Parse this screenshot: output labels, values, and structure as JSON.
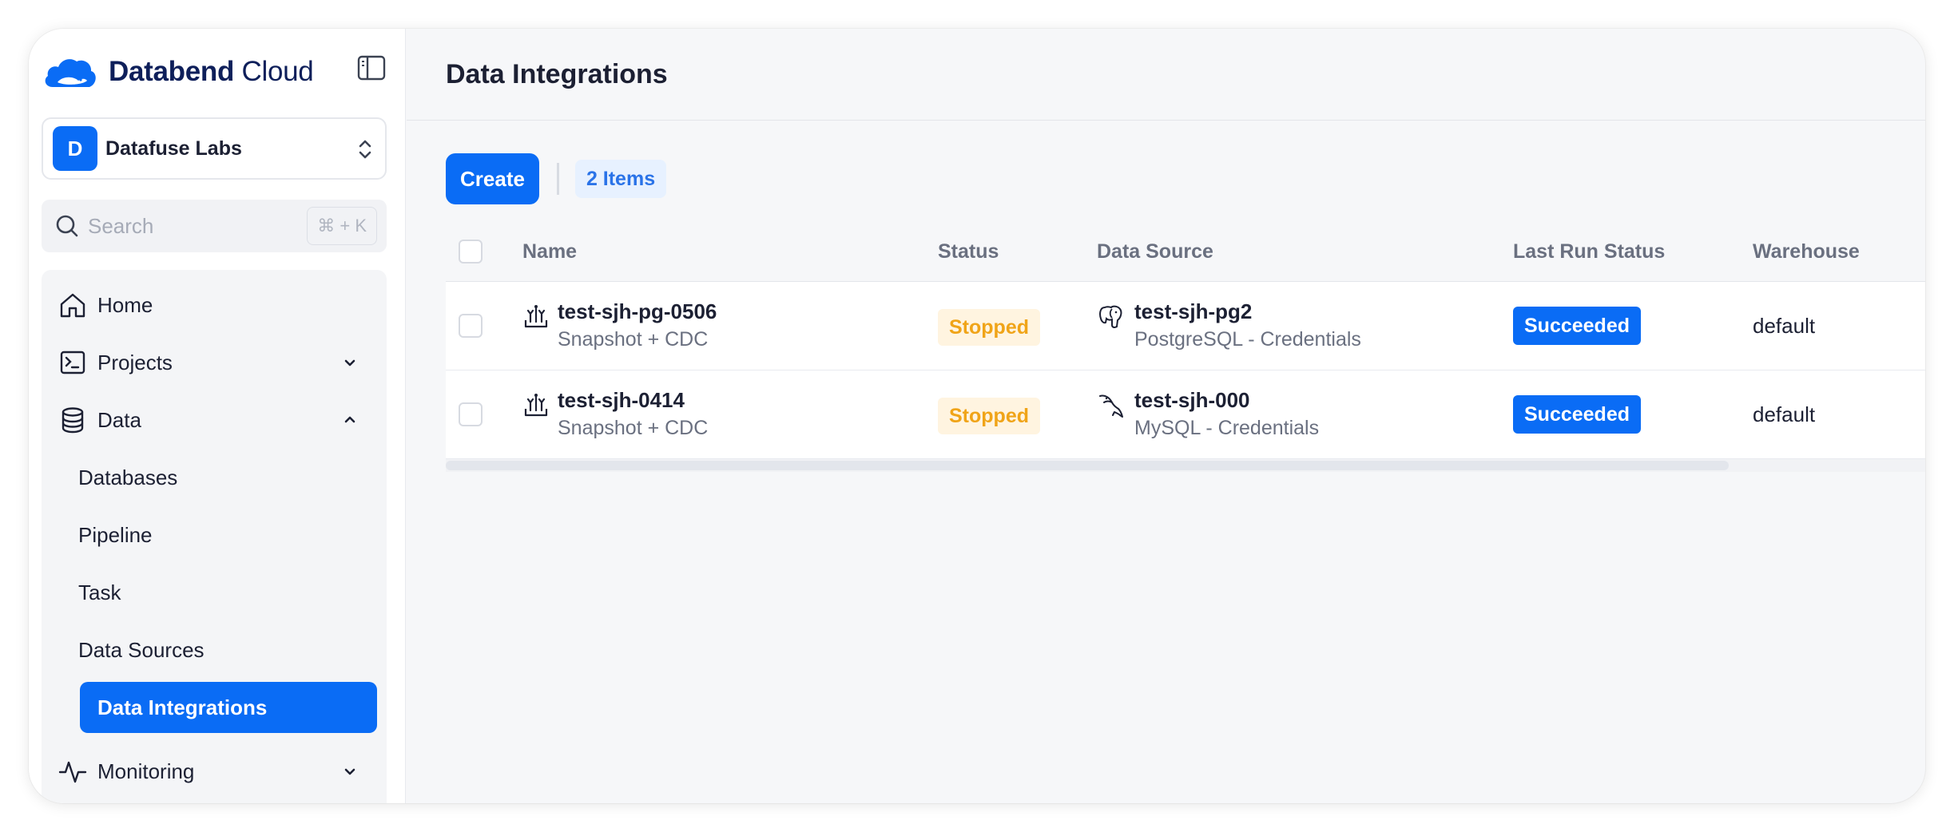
{
  "brand": {
    "name_bold": "Databend",
    "name_light": " Cloud"
  },
  "org": {
    "initial": "D",
    "name": "Datafuse Labs"
  },
  "search": {
    "placeholder": "Search",
    "shortcut": "⌘ + K"
  },
  "nav": {
    "home": "Home",
    "projects": "Projects",
    "data": "Data",
    "data_children": [
      "Databases",
      "Pipeline",
      "Task",
      "Data Sources",
      "Data Integrations"
    ],
    "monitoring": "Monitoring",
    "active": "Data Integrations"
  },
  "page": {
    "title": "Data Integrations"
  },
  "toolbar": {
    "create_label": "Create",
    "count_label": "2 Items"
  },
  "table": {
    "columns": [
      "Name",
      "Status",
      "Data Source",
      "Last Run Status",
      "Warehouse"
    ],
    "rows": [
      {
        "name": "test-sjh-pg-0506",
        "mode": "Snapshot + CDC",
        "status": "Stopped",
        "source_name": "test-sjh-pg2",
        "source_type": "PostgreSQL - Credentials",
        "source_icon": "postgresql-icon",
        "last_run": "Succeeded",
        "warehouse": "default"
      },
      {
        "name": "test-sjh-0414",
        "mode": "Snapshot + CDC",
        "status": "Stopped",
        "source_name": "test-sjh-000",
        "source_type": "MySQL - Credentials",
        "source_icon": "mysql-icon",
        "last_run": "Succeeded",
        "warehouse": "default"
      }
    ]
  },
  "colors": {
    "accent": "#0a6cf5",
    "stopped_text": "#f0a418",
    "stopped_bg": "#fff4e0",
    "brand_text": "#0e1f5a"
  }
}
